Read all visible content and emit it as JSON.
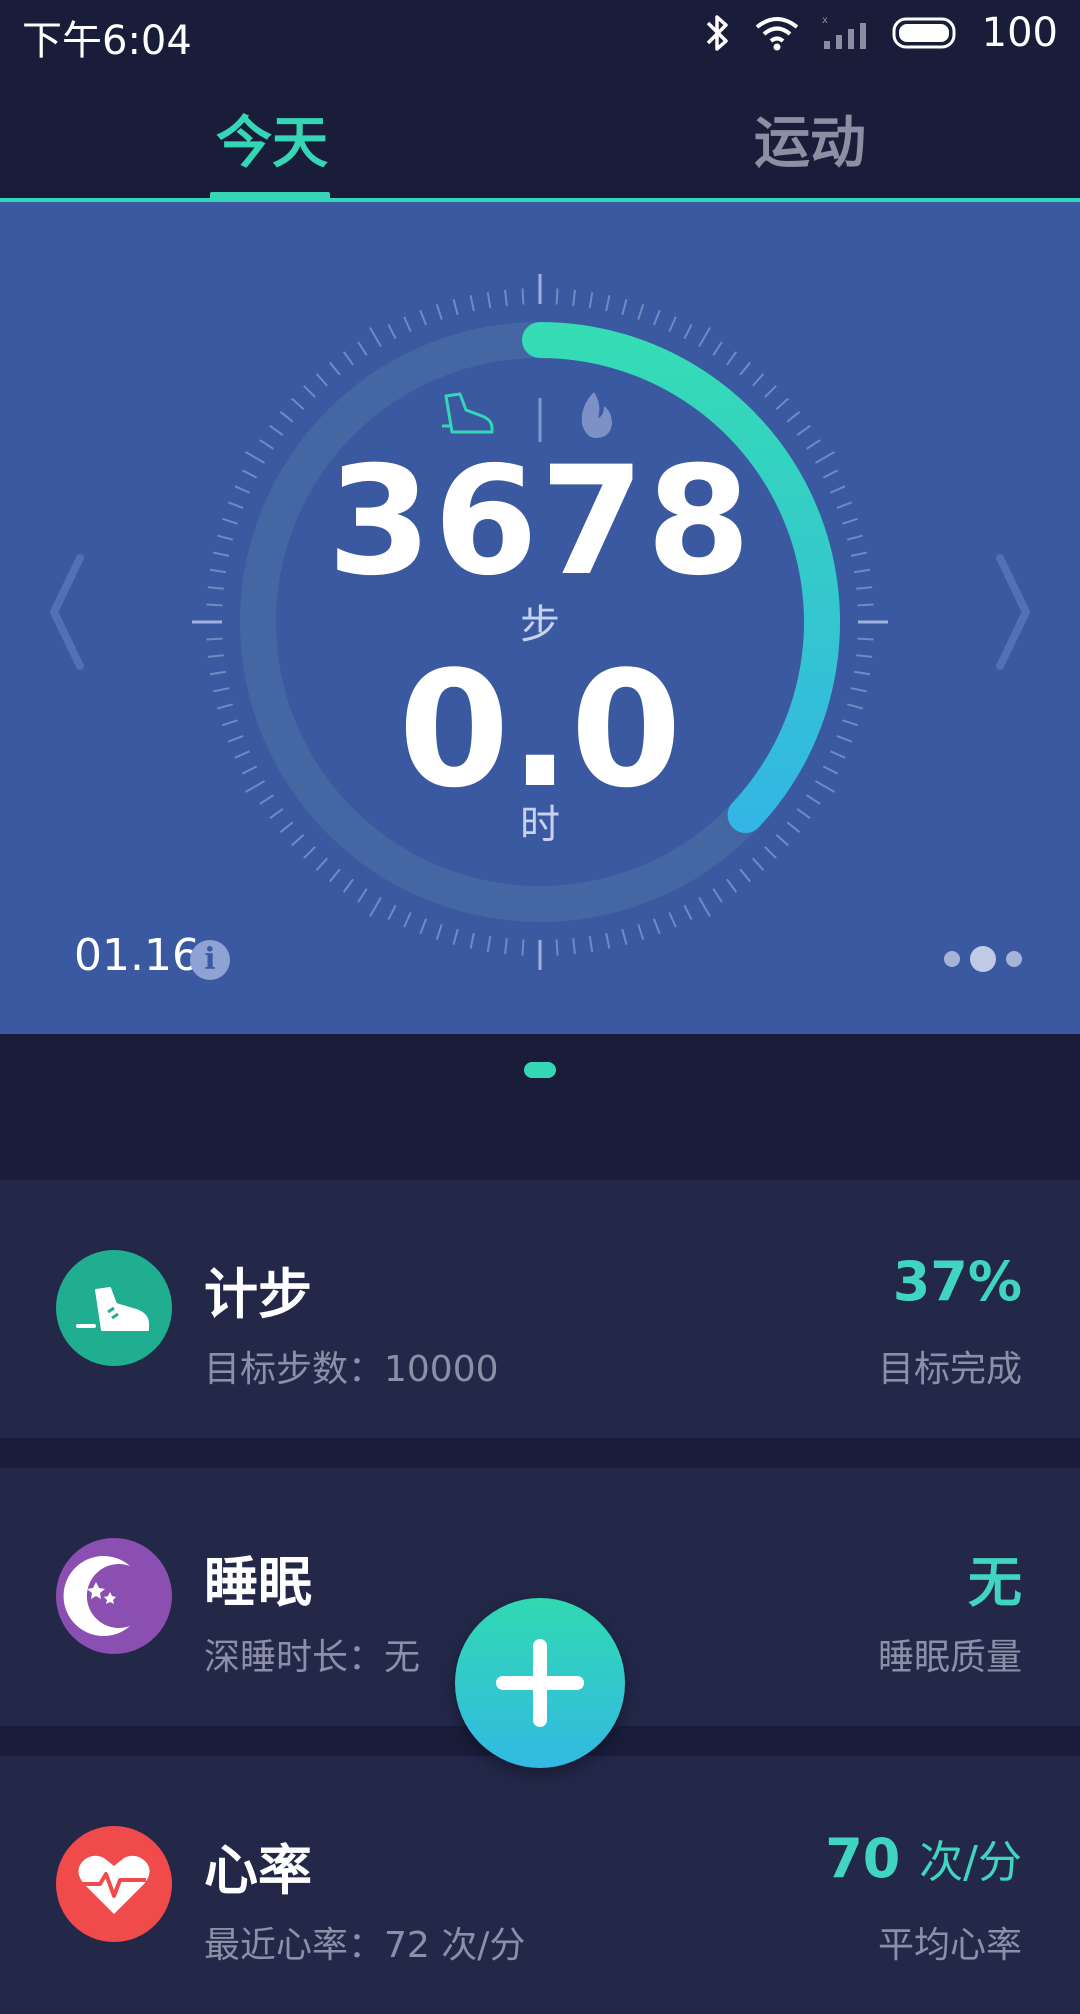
{
  "status_bar": {
    "time": "下午6:04",
    "battery": "100"
  },
  "tabs": [
    {
      "label": "今天"
    },
    {
      "label": "运动"
    }
  ],
  "hero": {
    "steps": "3678",
    "steps_unit": "步",
    "hours": "0.0",
    "hours_unit": "时",
    "date": "01.16",
    "progress_fraction": 0.37,
    "icons": [
      "shoe-icon",
      "flame-icon"
    ]
  },
  "cards": [
    {
      "title": "计步",
      "subtitle": "目标步数：10000",
      "value": "37%",
      "value_unit": "",
      "label": "目标完成",
      "icon": "shoe-icon",
      "icon_color": "#1fae8f"
    },
    {
      "title": "睡眠",
      "subtitle": "深睡时长：无",
      "value": "无",
      "value_unit": "",
      "label": "睡眠质量",
      "icon": "moon-icon",
      "icon_color": "#8a4fb0"
    },
    {
      "title": "心率",
      "subtitle": "最近心率：72 次/分",
      "value": "70",
      "value_unit": "次/分",
      "label": "平均心率",
      "icon": "heart-icon",
      "icon_color": "#f04a4a"
    }
  ],
  "colors": {
    "accent": "#35d6b5",
    "hero_bg": "#3b59a0",
    "page_bg": "#191d3a",
    "card_bg": "#232849"
  }
}
